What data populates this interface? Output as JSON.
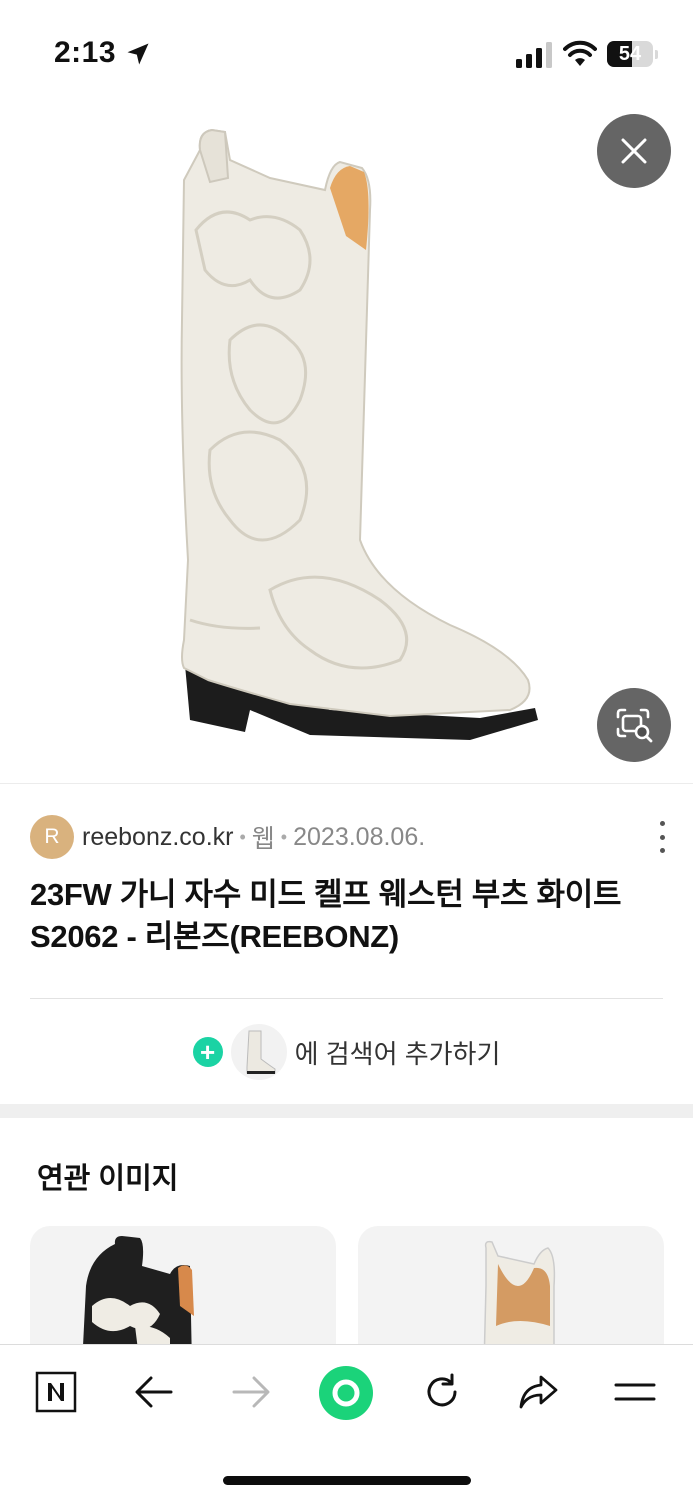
{
  "status_bar": {
    "time": "2:13",
    "battery_percent": "54",
    "battery_level": 0.54
  },
  "hero": {
    "image_subject": "white-western-boot",
    "close_icon": "close-icon",
    "lens_icon": "image-search-icon"
  },
  "result": {
    "favicon_letter": "R",
    "favicon_color": "#d9b27e",
    "domain": "reebonz.co.kr",
    "type": "웹",
    "date": "2023.08.06.",
    "title": "23FW 가니 자수 미드 켈프 웨스턴 부츠 화이트 S2062 - 리본즈(REEBONZ)"
  },
  "add_search": {
    "plus": "+",
    "label": "에 검색어 추가하기",
    "accent": "#1bd3a4"
  },
  "related": {
    "title": "연관 이미지",
    "cards": [
      {
        "subject": "black-western-boot"
      },
      {
        "subject": "white-western-boot"
      }
    ]
  },
  "toolbar": {
    "items": [
      {
        "icon": "naver-home-icon"
      },
      {
        "icon": "back-arrow-icon"
      },
      {
        "icon": "forward-arrow-icon"
      },
      {
        "icon": "green-dot-icon"
      },
      {
        "icon": "reload-icon"
      },
      {
        "icon": "share-icon"
      },
      {
        "icon": "menu-icon"
      }
    ],
    "accent": "#1bd37a"
  }
}
